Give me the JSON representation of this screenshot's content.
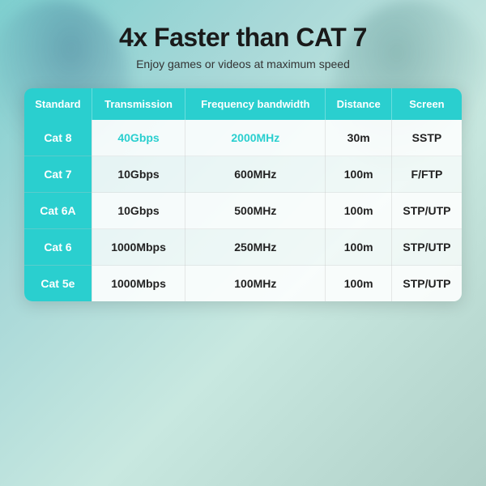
{
  "header": {
    "title": "4x Faster than CAT 7",
    "subtitle": "Enjoy games or videos at maximum speed"
  },
  "table": {
    "columns": [
      {
        "id": "standard",
        "label": "Standard"
      },
      {
        "id": "transmission",
        "label": "Transmission"
      },
      {
        "id": "frequency",
        "label": "Frequency bandwidth"
      },
      {
        "id": "distance",
        "label": "Distance"
      },
      {
        "id": "screen",
        "label": "Screen"
      }
    ],
    "rows": [
      {
        "standard": "Cat 8",
        "transmission": "40Gbps",
        "frequency": "2000MHz",
        "distance": "30m",
        "screen": "SSTP"
      },
      {
        "standard": "Cat 7",
        "transmission": "10Gbps",
        "frequency": "600MHz",
        "distance": "100m",
        "screen": "F/FTP"
      },
      {
        "standard": "Cat 6A",
        "transmission": "10Gbps",
        "frequency": "500MHz",
        "distance": "100m",
        "screen": "STP/UTP"
      },
      {
        "standard": "Cat 6",
        "transmission": "1000Mbps",
        "frequency": "250MHz",
        "distance": "100m",
        "screen": "STP/UTP"
      },
      {
        "standard": "Cat 5e",
        "transmission": "1000Mbps",
        "frequency": "100MHz",
        "distance": "100m",
        "screen": "STP/UTP"
      }
    ]
  },
  "colors": {
    "accent": "#2acfcf",
    "highlight_text": "#2acfcf",
    "title": "#1a1a1a",
    "subtitle": "#333333",
    "header_bg": "#2acfcf",
    "header_text": "#ffffff",
    "row_standard_bg": "#2acfcf",
    "row_standard_text": "#ffffff"
  }
}
